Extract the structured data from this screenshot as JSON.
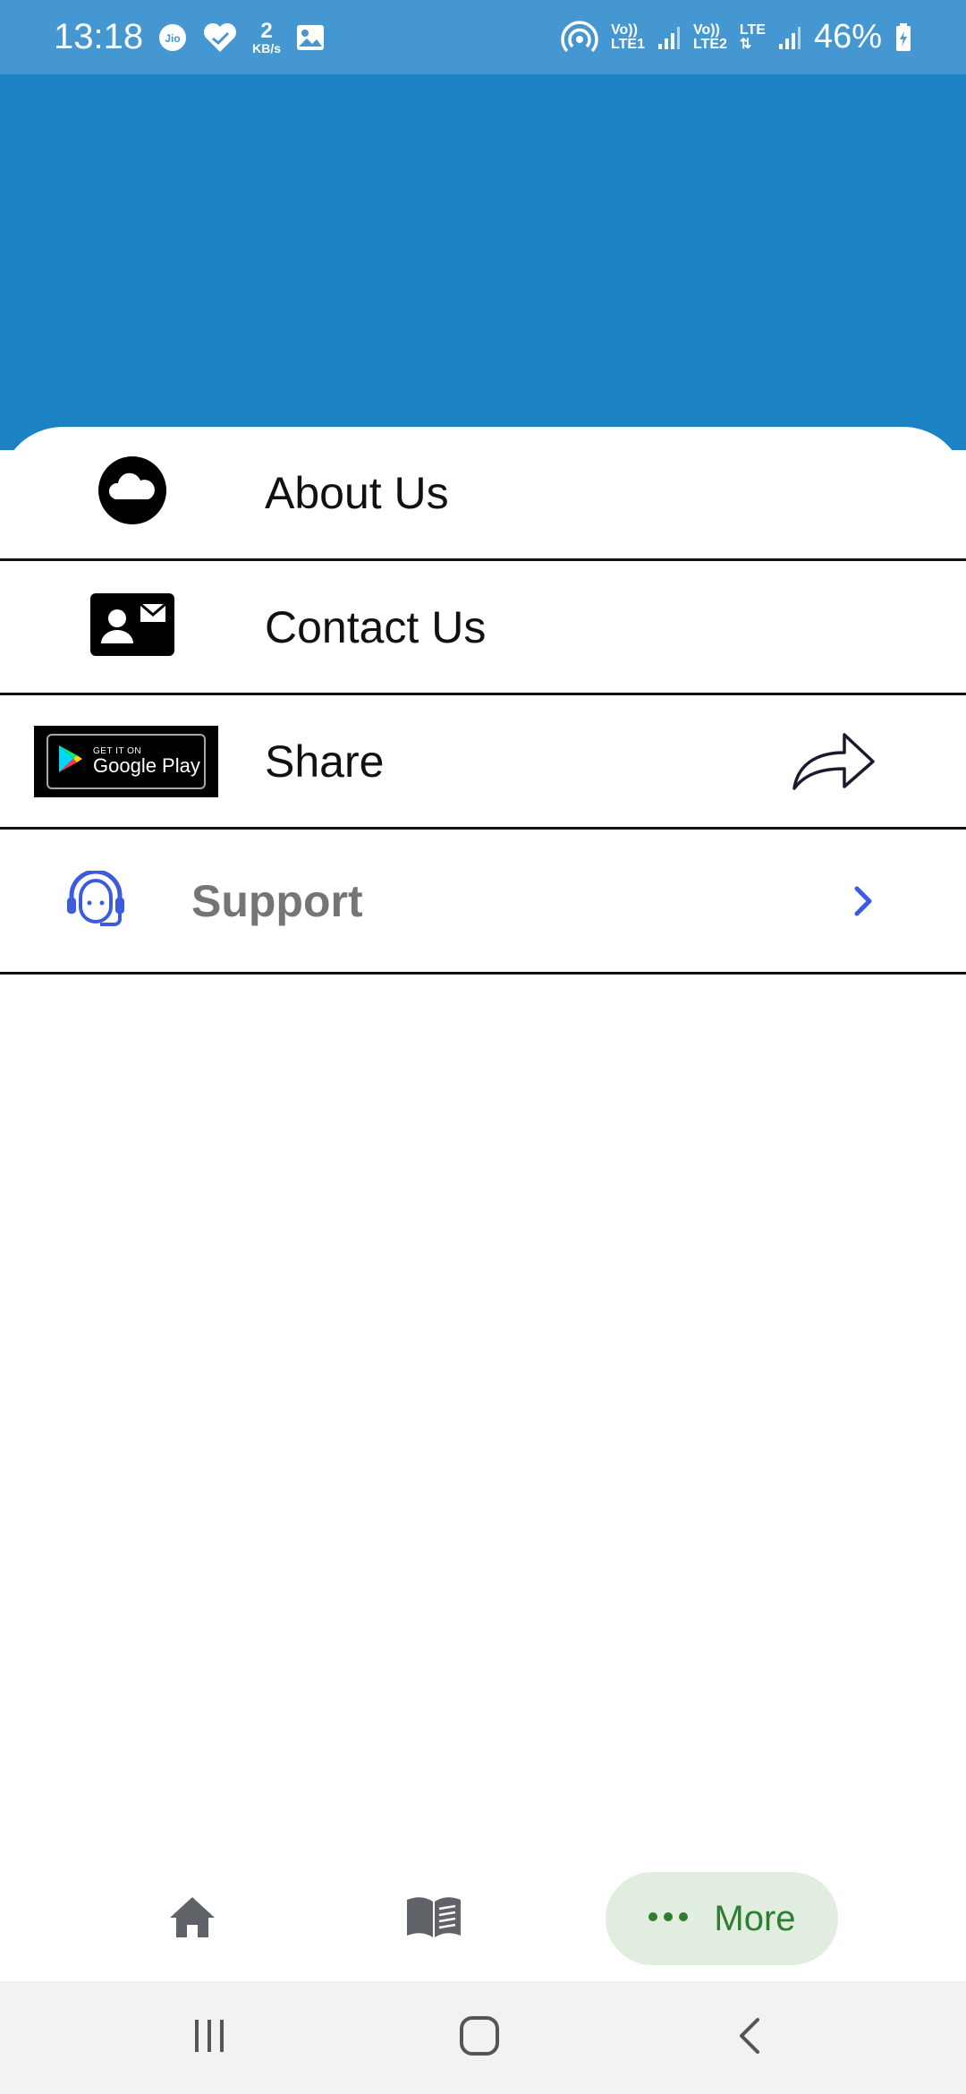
{
  "status_bar": {
    "time": "13:18",
    "net_speed_value": "2",
    "net_speed_unit": "KB/s",
    "sim1_top": "Vo))",
    "sim1_bottom": "LTE1",
    "sim2_top": "Vo))",
    "sim2_bottom": "LTE2",
    "lte_label": "LTE",
    "battery": "46%",
    "icons": [
      "jio-icon",
      "heart-check-icon",
      "gallery-icon",
      "hotspot-icon",
      "signal-icon",
      "battery-charging-icon"
    ]
  },
  "menu": {
    "items": [
      {
        "label": "About Us",
        "icon": "cloud-icon"
      },
      {
        "label": "Contact Us",
        "icon": "contact-card-icon"
      },
      {
        "label": "Share",
        "icon": "google-play-badge",
        "trailing_icon": "share-arrow-icon"
      }
    ],
    "google_play": {
      "small": "GET IT ON",
      "big": "Google Play"
    },
    "support": {
      "label": "Support",
      "icon": "headset-agent-icon",
      "trailing_icon": "chevron-right-icon"
    }
  },
  "bottom_nav": {
    "items": [
      {
        "icon": "home-icon"
      },
      {
        "icon": "book-icon"
      },
      {
        "icon": "more-dots-icon",
        "label": "More",
        "active": true
      }
    ]
  },
  "colors": {
    "status_bar": "#4497d0",
    "header": "#1b82c3",
    "accent_blue": "#3d5bdf",
    "more_pill_bg": "#e0eddf",
    "more_text": "#2e7d32"
  }
}
